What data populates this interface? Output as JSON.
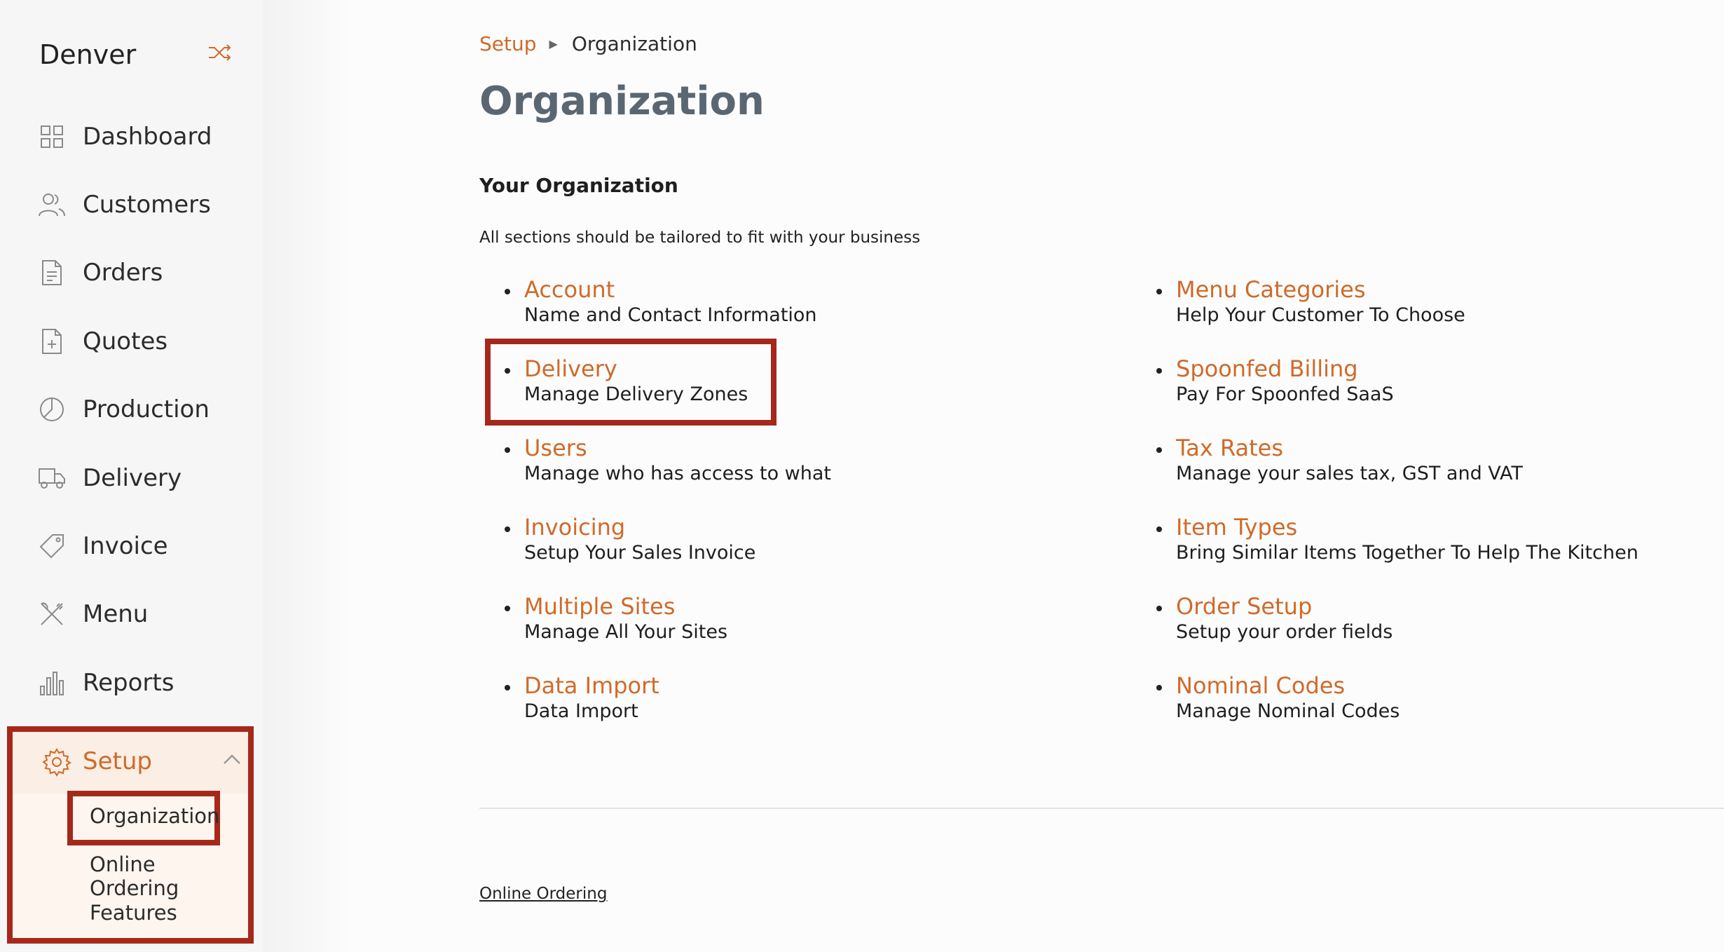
{
  "sidebar": {
    "brand": "Denver",
    "items": [
      {
        "label": "Dashboard",
        "icon": "dashboard-grid-icon"
      },
      {
        "label": "Customers",
        "icon": "customers-icon"
      },
      {
        "label": "Orders",
        "icon": "orders-document-icon"
      },
      {
        "label": "Quotes",
        "icon": "quotes-document-plus-icon"
      },
      {
        "label": "Production",
        "icon": "production-pie-icon"
      },
      {
        "label": "Delivery",
        "icon": "delivery-truck-icon"
      },
      {
        "label": "Invoice",
        "icon": "invoice-tag-icon"
      },
      {
        "label": "Menu",
        "icon": "menu-utensils-icon"
      },
      {
        "label": "Reports",
        "icon": "reports-bars-icon"
      }
    ],
    "setup": {
      "label": "Setup",
      "icon": "gear-icon",
      "expanded": true,
      "sub_items": [
        "Organization",
        "Online Ordering",
        "Features"
      ],
      "active_sub_item": "Organization"
    }
  },
  "breadcrumb": {
    "parent": "Setup",
    "current": "Organization"
  },
  "page": {
    "title": "Organization",
    "section_heading": "Your Organization",
    "section_desc": "All sections should be tailored to fit with your business"
  },
  "links_left": [
    {
      "title": "Account",
      "desc": "Name and Contact Information"
    },
    {
      "title": "Delivery",
      "desc": "Manage Delivery Zones"
    },
    {
      "title": "Users",
      "desc": "Manage who has access to what"
    },
    {
      "title": "Invoicing",
      "desc": "Setup Your Sales Invoice"
    },
    {
      "title": "Multiple Sites",
      "desc": "Manage All Your Sites"
    },
    {
      "title": "Data Import",
      "desc": "Data Import"
    }
  ],
  "links_right": [
    {
      "title": "Menu Categories",
      "desc": "Help Your Customer To Choose"
    },
    {
      "title": "Spoonfed Billing",
      "desc": "Pay For Spoonfed SaaS"
    },
    {
      "title": "Tax Rates",
      "desc": "Manage your sales tax, GST and VAT"
    },
    {
      "title": "Item Types",
      "desc": "Bring Similar Items Together To Help The Kitchen"
    },
    {
      "title": "Order Setup",
      "desc": "Setup your order fields"
    },
    {
      "title": "Nominal Codes",
      "desc": "Manage Nominal Codes"
    }
  ],
  "footer": {
    "link": "Online Ordering"
  },
  "colors": {
    "accent": "#cf6a2a",
    "highlight": "#a5281b",
    "title": "#5a6773"
  }
}
